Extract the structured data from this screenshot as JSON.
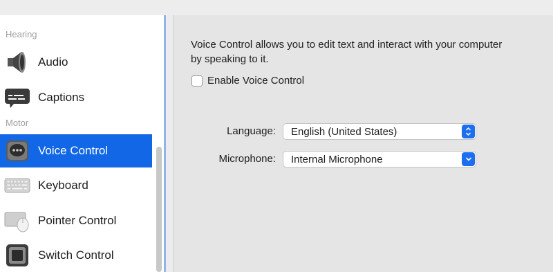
{
  "sidebar": {
    "sections": [
      {
        "label": "Hearing"
      },
      {
        "label": "Motor"
      }
    ],
    "items": [
      {
        "label": "Audio",
        "icon": "speaker-icon"
      },
      {
        "label": "Captions",
        "icon": "captions-icon"
      },
      {
        "label": "Voice Control",
        "icon": "voice-control-icon",
        "selected": true
      },
      {
        "label": "Keyboard",
        "icon": "keyboard-icon"
      },
      {
        "label": "Pointer Control",
        "icon": "pointer-control-icon"
      },
      {
        "label": "Switch Control",
        "icon": "switch-control-icon"
      }
    ]
  },
  "main": {
    "description": "Voice Control allows you to edit text and interact with your computer by speaking to it.",
    "enable_checkbox": {
      "label": "Enable Voice Control",
      "checked": false
    },
    "language": {
      "label": "Language:",
      "value": "English (United States)"
    },
    "microphone": {
      "label": "Microphone:",
      "value": "Internal Microphone"
    }
  },
  "colors": {
    "selection": "#1167e6",
    "popup_button": "#1d6ff0",
    "sidebar_border": "#8fb4ea"
  }
}
